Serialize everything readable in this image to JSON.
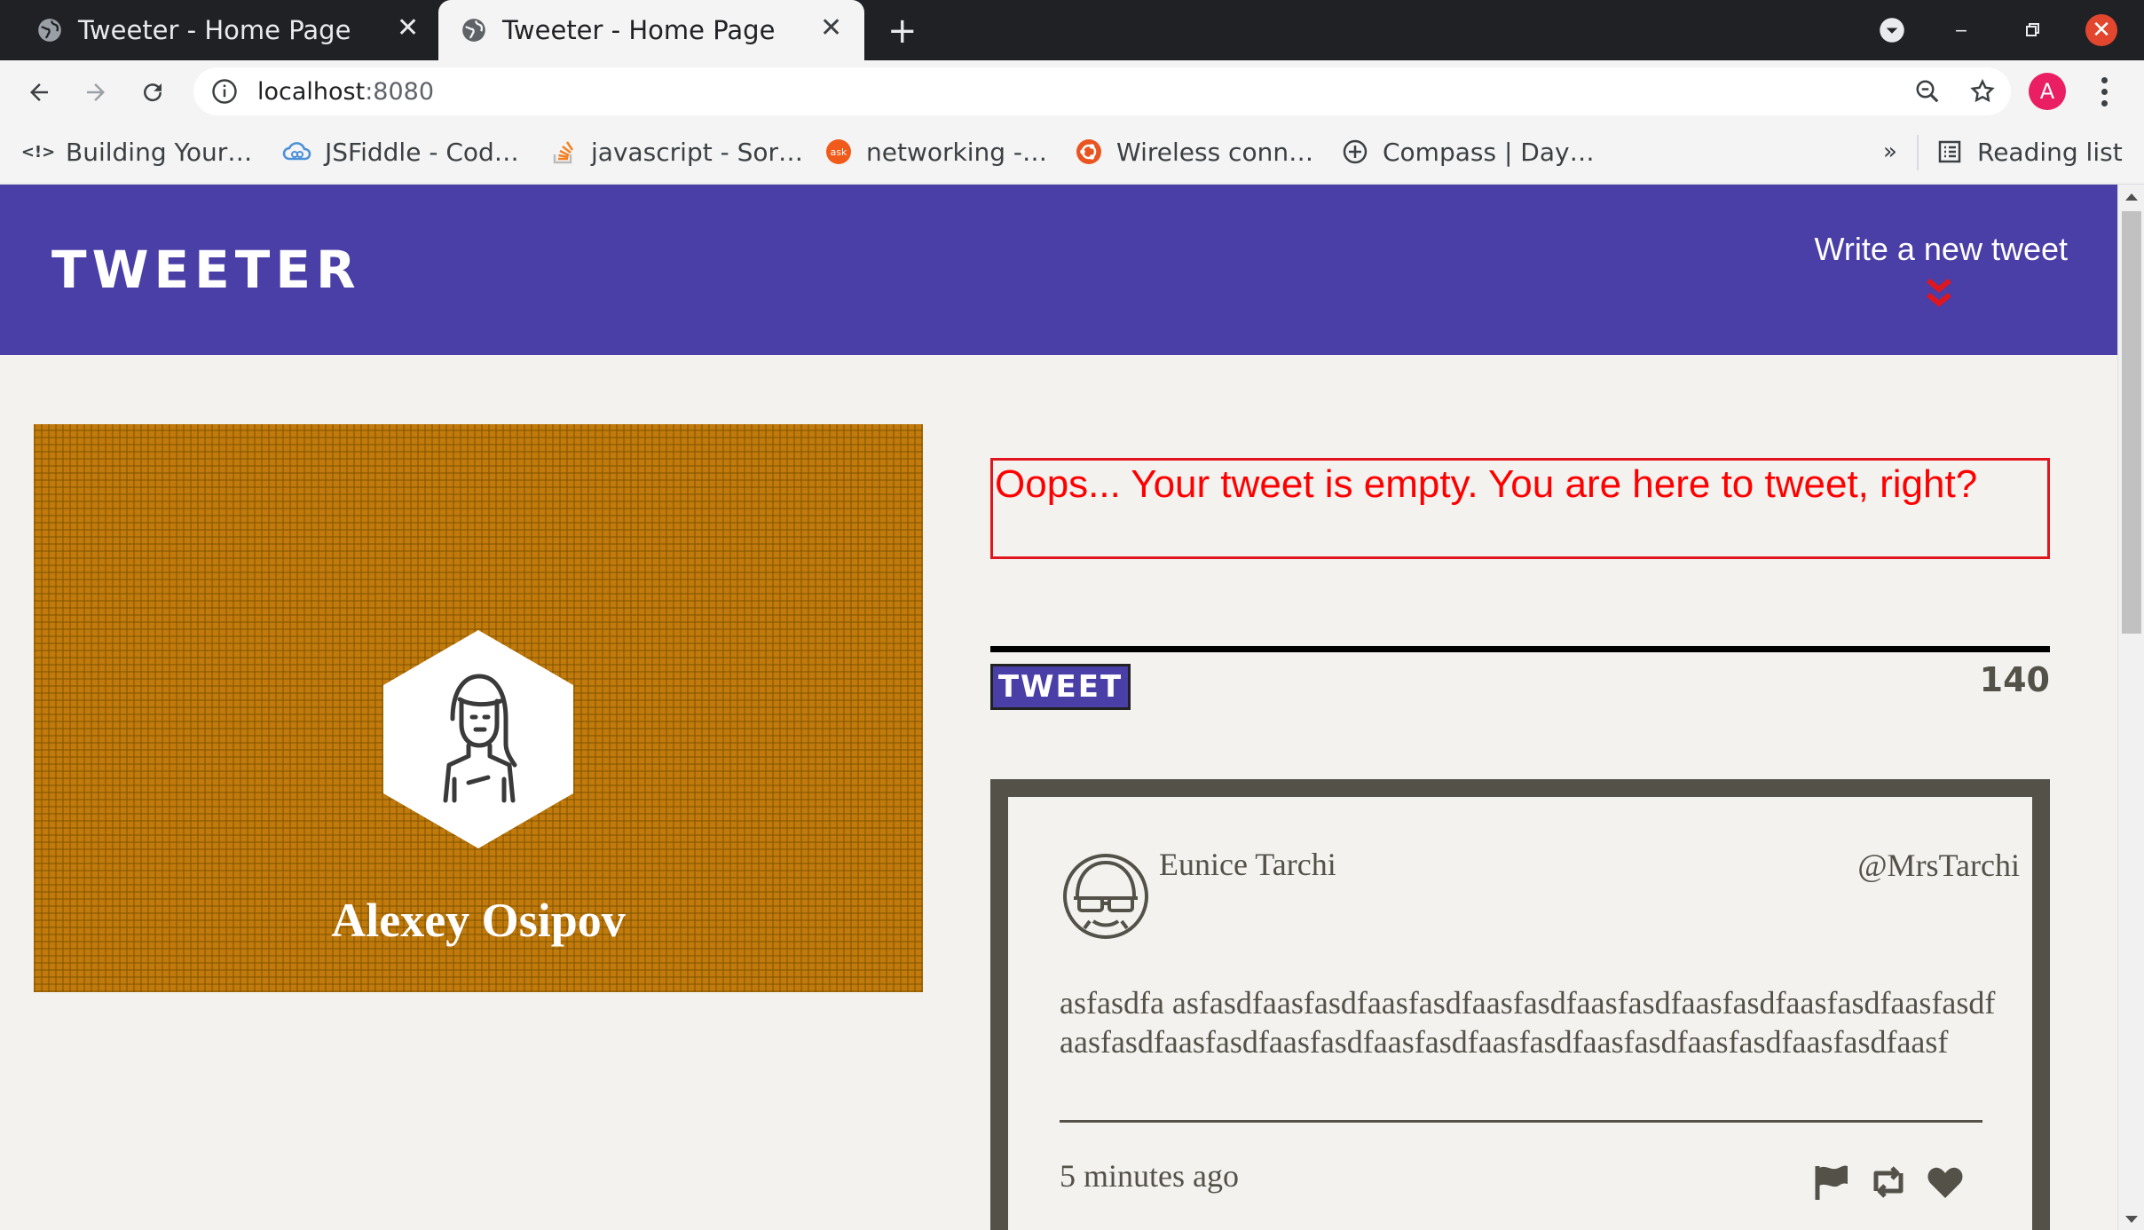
{
  "browser": {
    "tabs": [
      {
        "title": "Tweeter - Home Page",
        "active": false
      },
      {
        "title": "Tweeter - Home Page",
        "active": true
      }
    ],
    "new_tab_icon": "plus-icon",
    "url_host": "localhost",
    "url_port": ":8080",
    "bookmarks": [
      {
        "label": "Building Your…",
        "icon": "code-icon"
      },
      {
        "label": "JSFiddle - Cod…",
        "icon": "cloud-icon"
      },
      {
        "label": "javascript - Sor…",
        "icon": "stackoverflow-icon"
      },
      {
        "label": "networking -…",
        "icon": "askubuntu-icon"
      },
      {
        "label": "Wireless conn…",
        "icon": "ubuntu-icon"
      },
      {
        "label": "Compass | Day…",
        "icon": "compass-icon"
      }
    ],
    "more_bookmarks": "»",
    "reading_list": "Reading list",
    "profile_initial": "A",
    "colors": {
      "tabstrip": "#202124",
      "close": "#e2462e",
      "avatar": "#e91e63"
    }
  },
  "header": {
    "logo": "Tweeter",
    "write_new": "Write a new tweet",
    "colors": {
      "bg": "#4a3ea7",
      "chevron": "#e0161e"
    }
  },
  "profile": {
    "name": "Alexey Osipov",
    "colors": {
      "bg": "#c17a0b"
    }
  },
  "compose": {
    "error": "Oops... Your tweet is empty. You are here to tweet, right?",
    "submit_label": "Tweet",
    "counter": "140"
  },
  "tweets": [
    {
      "name": "Eunice Tarchi",
      "handle": "@MrsTarchi",
      "content": "asfasdfa asfasdfaasfasdfaasfasdfaasfasdfaasfasdfaasfasdfaasfasdfaasfasdfaasfasdfaasfasdfaasfasdfaasfasdfaasfasdfaasfasdfaasfasdfaasfasdfaasf",
      "time": "5 minutes ago",
      "actions": [
        "flag-icon",
        "retweet-icon",
        "heart-icon"
      ]
    }
  ]
}
